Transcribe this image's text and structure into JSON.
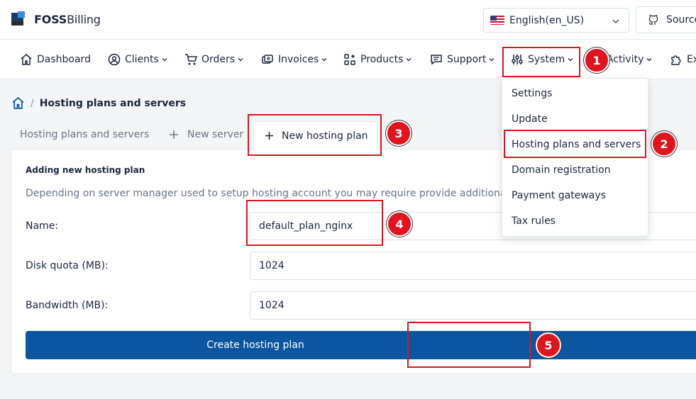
{
  "header": {
    "logo_bold": "FOSS",
    "logo_rest": "Billing",
    "language": "English(en_US)",
    "source_label": "Source"
  },
  "nav": {
    "dashboard": "Dashboard",
    "clients": "Clients",
    "orders": "Orders",
    "invoices": "Invoices",
    "products": "Products",
    "support": "Support",
    "system": "System",
    "activity": "Activity",
    "extensions": "Ex"
  },
  "breadcrumb": {
    "current": "Hosting plans and servers",
    "separator": "/"
  },
  "tabs": {
    "hosting_plans": "Hosting plans and servers",
    "new_server": "New server",
    "new_hosting_plan": "New hosting plan"
  },
  "form": {
    "title": "Adding new hosting plan",
    "description": "Depending on server manager used to setup hosting account you may require provide additional parameters to this step",
    "name_label": "Name:",
    "name_value": "default_plan_nginx",
    "disk_label": "Disk quota (MB):",
    "disk_value": "1024",
    "bandwidth_label": "Bandwidth (MB):",
    "bandwidth_value": "1024",
    "submit_label": "Create hosting plan"
  },
  "system_menu": {
    "items": [
      "Settings",
      "Update",
      "Hosting plans and servers",
      "Domain registration",
      "Payment gateways",
      "Tax rules"
    ]
  },
  "annotations": [
    "1",
    "2",
    "3",
    "4",
    "5"
  ],
  "colors": {
    "primary": "#0a56a0",
    "annotation": "#e0141e"
  }
}
